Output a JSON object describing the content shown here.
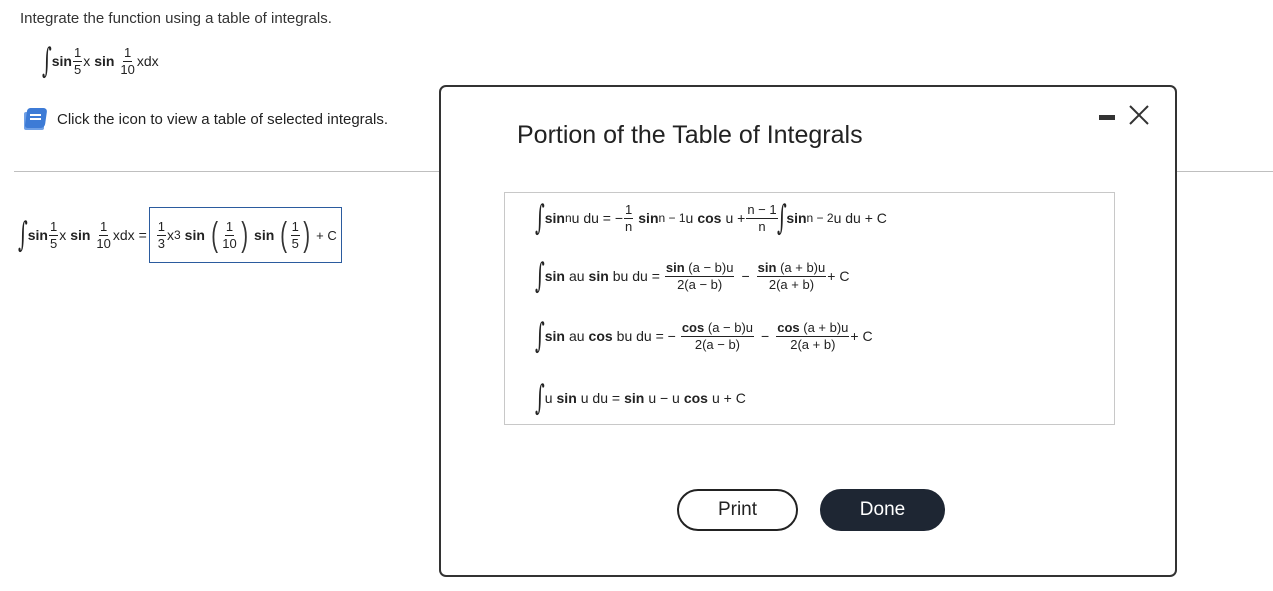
{
  "instruction": "Integrate the function using a table of integrals.",
  "problem": {
    "integral_sign": "∫",
    "sin1": "sin",
    "f1_num": "1",
    "f1_den": "5",
    "x1": "x",
    "sin2": "sin",
    "f2_num": "1",
    "f2_den": "10",
    "tail": "xdx"
  },
  "hint": {
    "icon": "book-icon",
    "text": "Click the icon to view a table of selected integrals."
  },
  "answer": {
    "lhs_sin1": "sin",
    "lhs_f1_num": "1",
    "lhs_f1_den": "5",
    "lhs_x": "x",
    "lhs_sin2": "sin",
    "lhs_f2_num": "1",
    "lhs_f2_den": "10",
    "lhs_tail": "xdx =",
    "coef_num": "1",
    "coef_den": "3",
    "x": "x",
    "exp": "3",
    "sin_a": "sin",
    "a_num": "1",
    "a_den": "10",
    "sin_b": "sin",
    "b_num": "1",
    "b_den": "5",
    "plus_c": "+ C"
  },
  "modal": {
    "title": "Portion of the Table of Integrals",
    "minimize_icon": "minimize-icon",
    "close_icon": "close-icon",
    "rows": [
      {
        "sin": "sin",
        "exp_n": "n",
        "u_du_eq": "u du = −",
        "f_num": "1",
        "f_den": "n",
        "sin2": "sin",
        "exp_n1": "n − 1",
        "u": "u",
        "cos": "cos",
        "u_plus": "u +",
        "f2_num": "n − 1",
        "f2_den": "n",
        "sin3": "sin",
        "exp_n2": "n − 2",
        "tail": "u du + C"
      },
      {
        "sin": "sin",
        "au": "au",
        "sin2": "sin",
        "bu_du_eq": "bu du =",
        "f1_num_fn": "sin",
        "f1_num": "(a − b)u",
        "f1_den": "2(a − b)",
        "minus": "−",
        "f2_num_fn": "sin",
        "f2_num": "(a + b)u",
        "f2_den": "2(a + b)",
        "tail": "+ C"
      },
      {
        "sin": "sin",
        "au": "au",
        "cos": "cos",
        "bu_du_eq": "bu du = −",
        "f1_num_fn": "cos",
        "f1_num": "(a − b)u",
        "f1_den": "2(a − b)",
        "minus": "−",
        "f2_num_fn": "cos",
        "f2_num": "(a + b)u",
        "f2_den": "2(a + b)",
        "tail": "+ C"
      },
      {
        "u": "u",
        "sin": "sin",
        "u_du_eq": "u du =",
        "sin2": "sin",
        "u_minus_u": "u − u",
        "cos": "cos",
        "tail": "u + C"
      }
    ],
    "print_label": "Print",
    "done_label": "Done"
  },
  "colors": {
    "book": "#3d7bd6",
    "answer_border": "#2b5b9e",
    "done_bg": "#1e2633"
  }
}
